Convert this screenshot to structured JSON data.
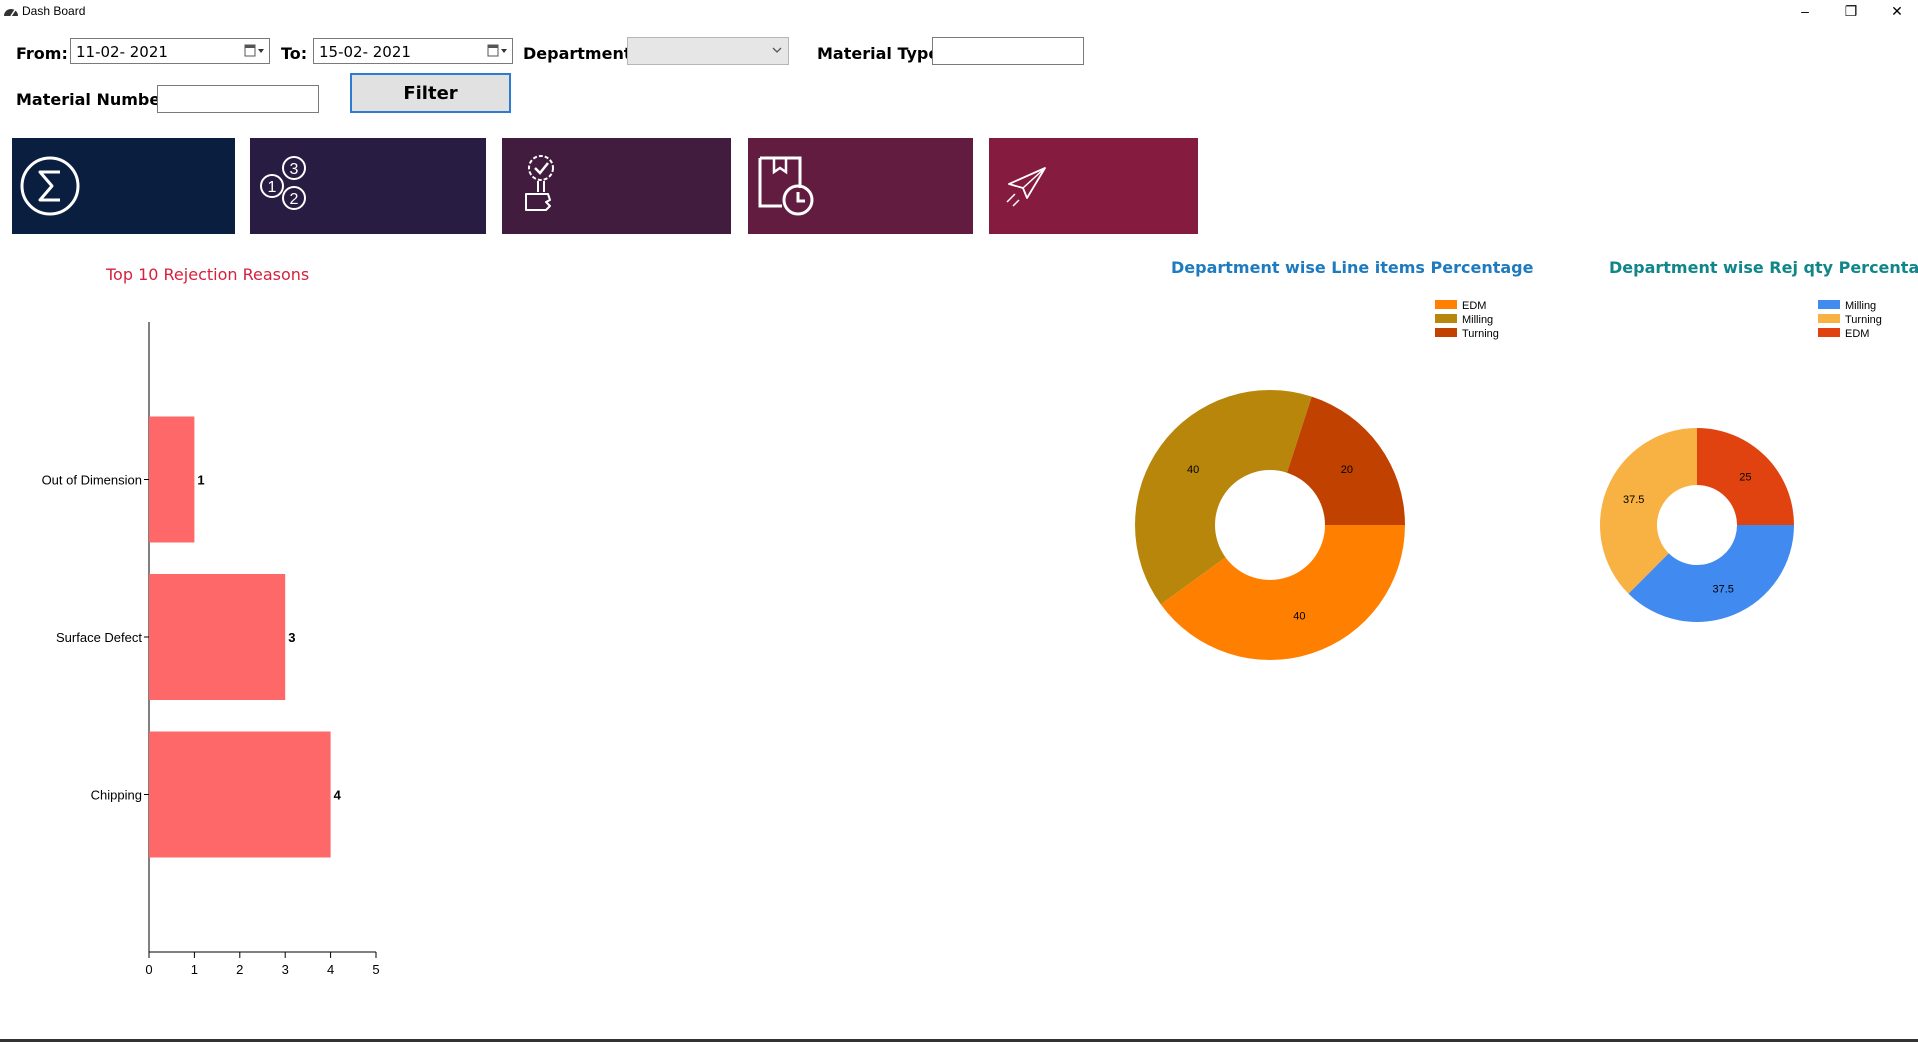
{
  "window": {
    "title": "Dash Board",
    "controls": {
      "minimize": "–",
      "restore": "❐",
      "close": "✕"
    }
  },
  "filters": {
    "from_label": "From:",
    "from_value": "11-02- 2021",
    "to_label": "To:",
    "to_value": "15-02- 2021",
    "department_label": "Department:",
    "department_value": "",
    "material_type_label": "Material Type:",
    "material_type_value": "",
    "material_number_label": "Material Number:",
    "material_number_value": "",
    "filter_button": "Filter"
  },
  "tiles": [
    {
      "icon": "sigma-icon",
      "color": "#0a1f3f"
    },
    {
      "icon": "numbered-bubbles-icon",
      "color": "#281c43"
    },
    {
      "icon": "approval-hand-icon",
      "color": "#411c3e"
    },
    {
      "icon": "book-clock-icon",
      "color": "#621c3f"
    },
    {
      "icon": "paper-plane-icon",
      "color": "#851c40"
    }
  ],
  "chart_data": [
    {
      "type": "bar",
      "orientation": "horizontal",
      "title": "Top 10 Rejection Reasons",
      "title_color": "#d6203d",
      "categories": [
        "Out of Dimension",
        "Surface Defect",
        "Chipping"
      ],
      "values": [
        1,
        3,
        4
      ],
      "xlim": [
        0,
        5
      ],
      "xticks": [
        "0",
        "1",
        "2",
        "3",
        "4",
        "5"
      ],
      "bar_color": "#ff6868",
      "grid": false
    },
    {
      "type": "pie",
      "style": "donut",
      "title": "Department wise Line items Percentage",
      "title_color": "#1e7bbf",
      "legend_position": "top-right",
      "slices": [
        {
          "label": "EDM",
          "value": 40,
          "text": "40",
          "color": "#ff7f00"
        },
        {
          "label": "Milling",
          "value": 40,
          "text": "40",
          "color": "#b8860b"
        },
        {
          "label": "Turning",
          "value": 20,
          "text": "20",
          "color": "#c14200"
        }
      ]
    },
    {
      "type": "pie",
      "style": "donut",
      "title": "Department wise Rej qty Percentage",
      "title_color": "#11868a",
      "legend_position": "top-right",
      "slices": [
        {
          "label": "Milling",
          "value": 37.5,
          "text": "37.5",
          "color": "#418af0"
        },
        {
          "label": "Turning",
          "value": 37.5,
          "text": "37.5",
          "color": "#f8b143"
        },
        {
          "label": "EDM",
          "value": 25,
          "text": "25",
          "color": "#e04310"
        }
      ]
    }
  ]
}
